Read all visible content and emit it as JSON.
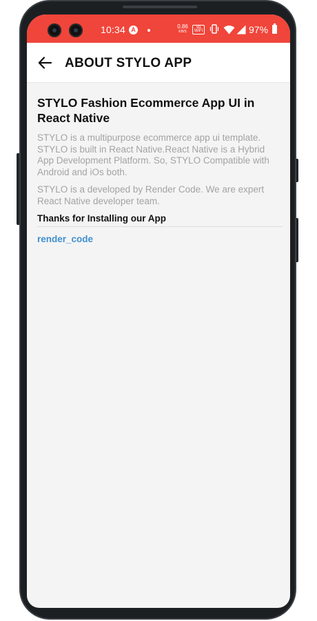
{
  "status_bar": {
    "time": "10:34",
    "app_icon": "A",
    "net_speed_value": "0.86",
    "net_speed_unit": "KB/S",
    "volte_label": "Vo WiFi",
    "battery_percent": "97%",
    "background_color": "#f0453a",
    "icons": [
      "app-notification-icon",
      "dot-icon",
      "vibrate-icon",
      "wifi-icon",
      "signal-icon",
      "battery-icon"
    ]
  },
  "header": {
    "back_icon": "arrow-left-icon",
    "title": "ABOUT STYLO APP"
  },
  "content": {
    "title": "STYLO Fashion Ecommerce App UI in React Native",
    "paragraph_1": "STYLO is a multipurpose ecommerce app ui template. STYLO is built in React Native.React Native is a Hybrid App Development Platform. So, STYLO Compatible with Android and iOs both.",
    "paragraph_2": "STYLO is a developed by Render Code. We are expert React Native developer team.",
    "thanks": "Thanks for Installing our App",
    "link": "render_code",
    "link_color": "#3f8fd0"
  }
}
